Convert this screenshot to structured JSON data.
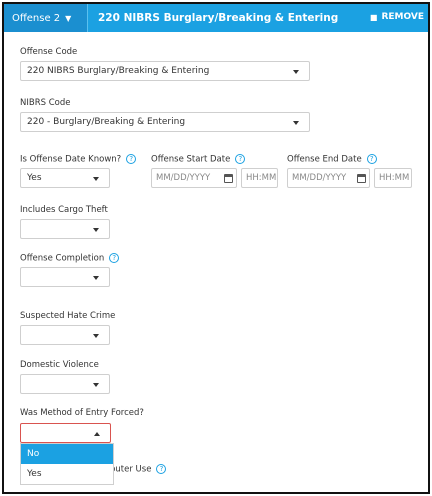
{
  "header": {
    "offense_tab": "Offense 2",
    "title": "220 NIBRS Burglary/Breaking & Entering",
    "remove_label": "REMOVE",
    "accent": "#1ba1e2"
  },
  "fields": {
    "offense_code": {
      "label": "Offense Code",
      "value": "220 NIBRS Burglary/Breaking & Entering"
    },
    "nibrs_code": {
      "label": "NIBRS Code",
      "value": "220 - Burglary/Breaking & Entering"
    },
    "offense_date_known": {
      "label": "Is Offense Date Known?",
      "value": "Yes"
    },
    "offense_start_date": {
      "label": "Offense Start Date",
      "date_placeholder": "MM/DD/YYYY",
      "time_placeholder": "HH:MM"
    },
    "offense_end_date": {
      "label": "Offense End Date",
      "date_placeholder": "MM/DD/YYYY",
      "time_placeholder": "HH:MM"
    },
    "cargo_theft": {
      "label": "Includes Cargo Theft",
      "value": ""
    },
    "offense_completion": {
      "label": "Offense Completion",
      "value": ""
    },
    "hate_crime": {
      "label": "Suspected Hate Crime",
      "value": ""
    },
    "domestic_violence": {
      "label": "Domestic Violence",
      "value": ""
    },
    "method_of_entry": {
      "label": "Was Method of Entry Forced?",
      "value": "",
      "options": [
        "No",
        "Yes"
      ],
      "highlighted": "No"
    },
    "computer_use": {
      "label_partial": "puter Use"
    }
  },
  "icons": {
    "help": "help-circle-icon",
    "calendar": "calendar-icon",
    "trash": "trash-icon",
    "caret": "caret-down-icon"
  }
}
